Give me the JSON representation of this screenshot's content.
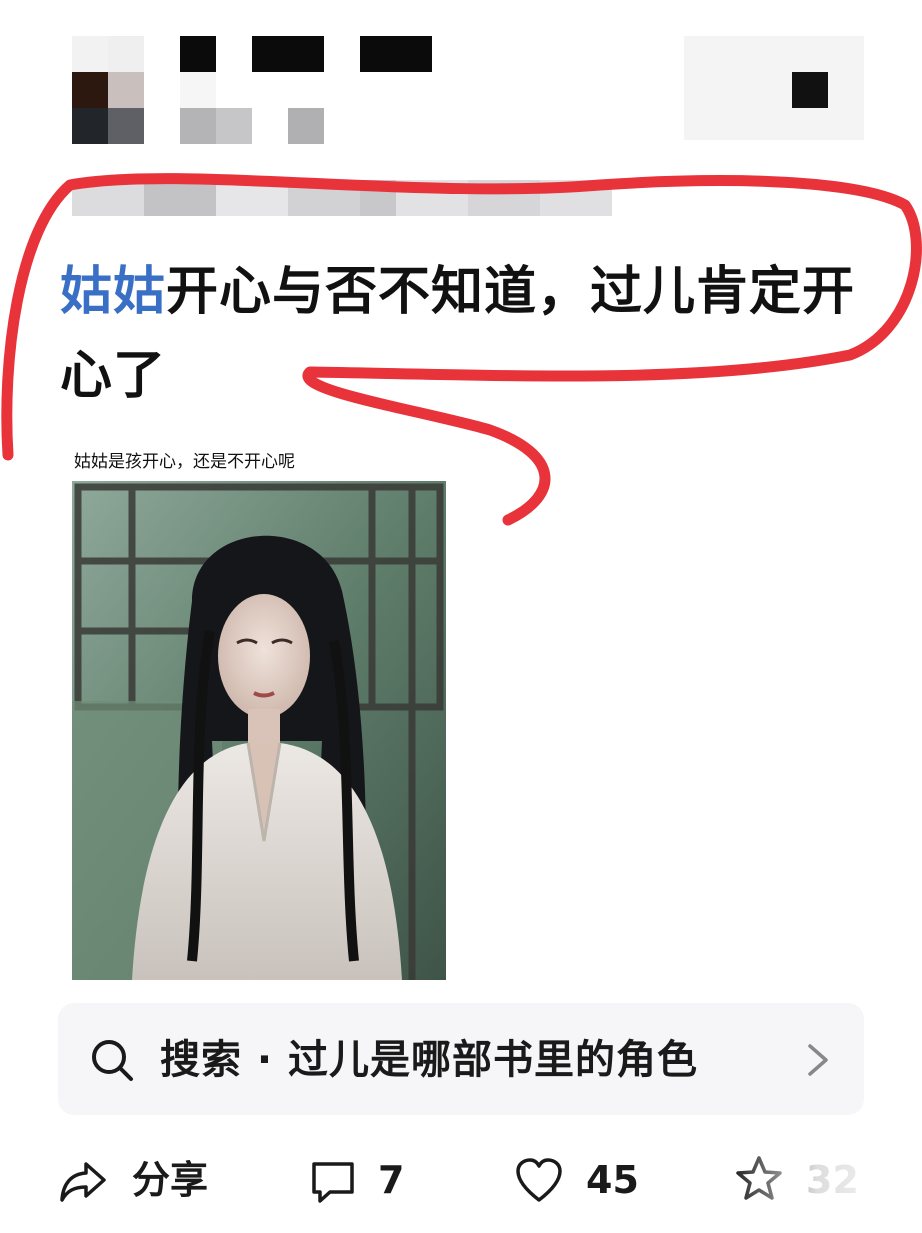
{
  "post": {
    "mention": "姑姑",
    "text": "开心与否不知道，过儿肯定开心了"
  },
  "image": {
    "caption": "姑姑是孩开心，还是不开心呢"
  },
  "search": {
    "label": "搜索 · 过儿是哪部书里的角色"
  },
  "actions": {
    "share": "分享",
    "comments": "7",
    "likes": "45",
    "favorites": "32"
  },
  "annotation": {
    "color": "#e8333b"
  }
}
